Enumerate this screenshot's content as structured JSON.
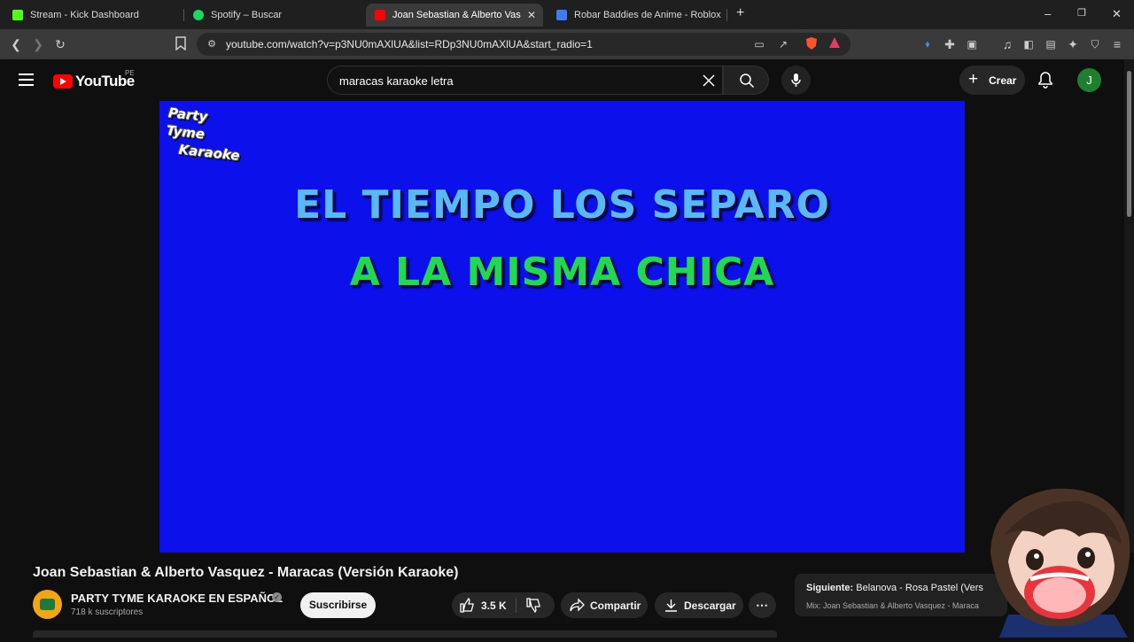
{
  "browser": {
    "tabs": [
      {
        "title": "Stream - Kick Dashboard",
        "favicon": "kick-icon",
        "color": "#53fc18",
        "active": false
      },
      {
        "title": "Spotify – Buscar",
        "favicon": "spotify-icon",
        "color": "#1ed760",
        "active": false
      },
      {
        "title": "Joan Sebastian & Alberto Vas",
        "favicon": "youtube-icon",
        "color": "#ff0000",
        "active": true
      },
      {
        "title": "Robar Baddies de Anime - Roblox",
        "favicon": "roblox-icon",
        "color": "#3d7cf0",
        "active": false
      }
    ],
    "url": "youtube.com/watch?v=p3NU0mAXlUA&list=RDp3NU0mAXlUA&start_radio=1"
  },
  "youtube": {
    "logo_text": "YouTube",
    "country": "PE",
    "search_query": "maracas karaoke letra",
    "create_label": "Crear",
    "avatar_letter": "J"
  },
  "video": {
    "logo_line1": "Party Tyme",
    "logo_line2": "Karaoke",
    "lyric_line1": "EL TIEMPO LOS SEPARO",
    "lyric_line2": "A LA MISMA CHICA",
    "background_color": "#0c10ea"
  },
  "info": {
    "title": "Joan Sebastian & Alberto Vasquez - Maracas (Versión Karaoke)",
    "channel": "PARTY TYME KARAOKE EN ESPAÑOL",
    "subscribers": "718 k suscriptores",
    "subscribe_label": "Suscribirse",
    "likes": "3.5 K",
    "share_label": "Compartir",
    "download_label": "Descargar",
    "next_prefix": "Siguiente:",
    "next_title": "Belanova - Rosa Pastel (Vers",
    "next_mix": "Mix: Joan Sebastian & Alberto Vasquez - Maraca"
  }
}
